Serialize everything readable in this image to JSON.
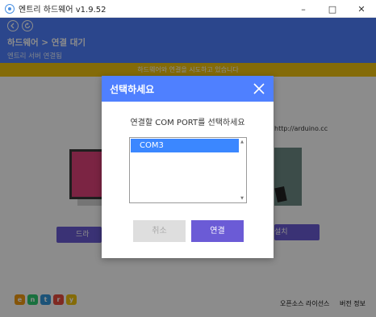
{
  "window": {
    "title": "엔트리 하드웨어 v1.9.52",
    "minimize": "–",
    "maximize": "□",
    "close": "✕"
  },
  "header": {
    "back_icon": "back-arrow-icon",
    "refresh_icon": "refresh-icon",
    "title": "하드웨어 > 연결 대기",
    "subtitle": "엔트리 서버 연결됨"
  },
  "notice": {
    "text": "하드웨어와 연결을 시도하고 있습니다"
  },
  "background": {
    "url_text": "http://arduino.cc",
    "left_button": "드라",
    "right_button": "설치"
  },
  "dialog": {
    "title": "선택하세요",
    "message": "연결할 COM PORT를 선택하세요",
    "ports": [
      "COM3"
    ],
    "cancel_label": "취소",
    "connect_label": "연결"
  },
  "footer": {
    "logo_letters": [
      "e",
      "n",
      "t",
      "r",
      "y"
    ],
    "license_link": "오픈소스 라이선스",
    "version_link": "버전 정보"
  },
  "colors": {
    "primary_blue": "#4f80ff",
    "notice_yellow": "#f1c40f",
    "button_purple": "#6b5bd6",
    "list_selection": "#3b87ff"
  }
}
